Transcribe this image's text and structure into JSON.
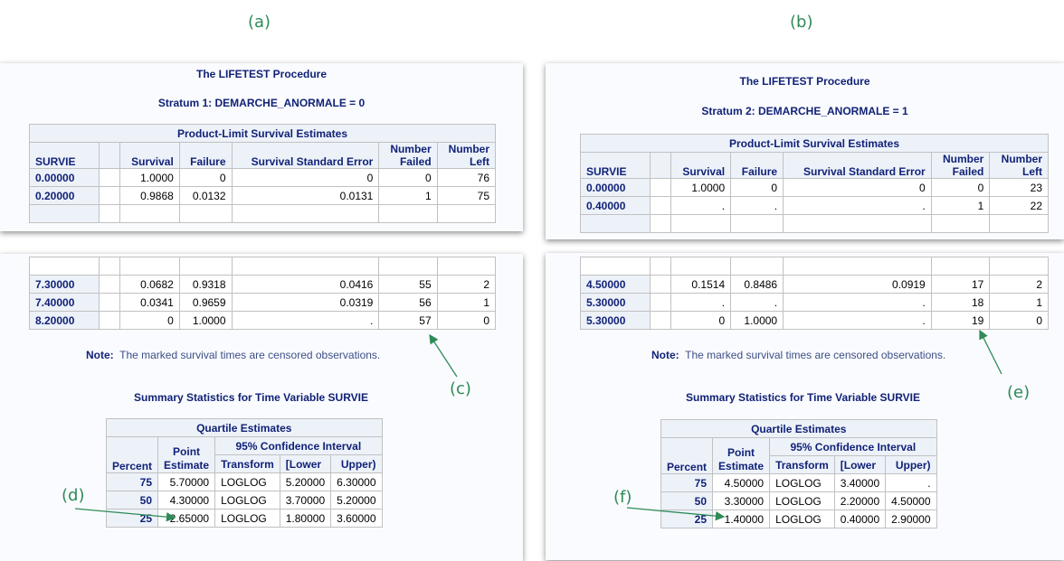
{
  "labels": {
    "a": "(a)",
    "b": "(b)",
    "c": "(c)",
    "d": "(d)",
    "e": "(e)",
    "f": "(f)"
  },
  "procedure_title": "The LIFETEST Procedure",
  "estimates_title": "Product-Limit Survival Estimates",
  "columns": {
    "survie": "SURVIE",
    "survival": "Survival",
    "failure": "Failure",
    "sse": "Survival Standard Error",
    "nf1": "Number",
    "nf2": "Failed",
    "nl1": "Number",
    "nl2": "Left"
  },
  "note_label": "Note:",
  "note_text": "The marked survival times are censored observations.",
  "summary_title": "Summary Statistics for Time Variable SURVIE",
  "quartile": {
    "title": "Quartile Estimates",
    "point1": "Point",
    "point2": "Estimate",
    "ci": "95% Confidence Interval",
    "percent": "Percent",
    "transform": "Transform",
    "lower": "[Lower",
    "upper": "Upper)"
  },
  "panel_a": {
    "stratum": "Stratum 1: DEMARCHE_ANORMALE = 0",
    "top_rows": [
      [
        "0.00000",
        "1.0000",
        "0",
        "0",
        "0",
        "76"
      ],
      [
        "0.20000",
        "0.9868",
        "0.0132",
        "0.0131",
        "1",
        "75"
      ]
    ],
    "bottom_rows": [
      [
        "7.30000",
        "0.0682",
        "0.9318",
        "0.0416",
        "55",
        "2"
      ],
      [
        "7.40000",
        "0.0341",
        "0.9659",
        "0.0319",
        "56",
        "1"
      ],
      [
        "8.20000",
        "0",
        "1.0000",
        ".",
        "57",
        "0"
      ]
    ],
    "quartiles": [
      [
        "75",
        "5.70000",
        "LOGLOG",
        "5.20000",
        "6.30000"
      ],
      [
        "50",
        "4.30000",
        "LOGLOG",
        "3.70000",
        "5.20000"
      ],
      [
        "25",
        "2.65000",
        "LOGLOG",
        "1.80000",
        "3.60000"
      ]
    ]
  },
  "panel_b": {
    "stratum": "Stratum 2: DEMARCHE_ANORMALE = 1",
    "top_rows": [
      [
        "0.00000",
        "1.0000",
        "0",
        "0",
        "0",
        "23"
      ],
      [
        "0.40000",
        ".",
        ".",
        ".",
        "1",
        "22"
      ]
    ],
    "bottom_rows": [
      [
        "4.50000",
        "0.1514",
        "0.8486",
        "0.0919",
        "17",
        "2"
      ],
      [
        "5.30000",
        ".",
        ".",
        ".",
        "18",
        "1"
      ],
      [
        "5.30000",
        "0",
        "1.0000",
        ".",
        "19",
        "0"
      ]
    ],
    "quartiles": [
      [
        "75",
        "4.50000",
        "LOGLOG",
        "3.40000",
        "."
      ],
      [
        "50",
        "3.30000",
        "LOGLOG",
        "2.20000",
        "4.50000"
      ],
      [
        "25",
        "1.40000",
        "LOGLOG",
        "0.40000",
        "2.90000"
      ]
    ]
  },
  "colors": {
    "label": "#2e8b57",
    "header_bg": "#edf2f9",
    "header_text": "#112277"
  }
}
